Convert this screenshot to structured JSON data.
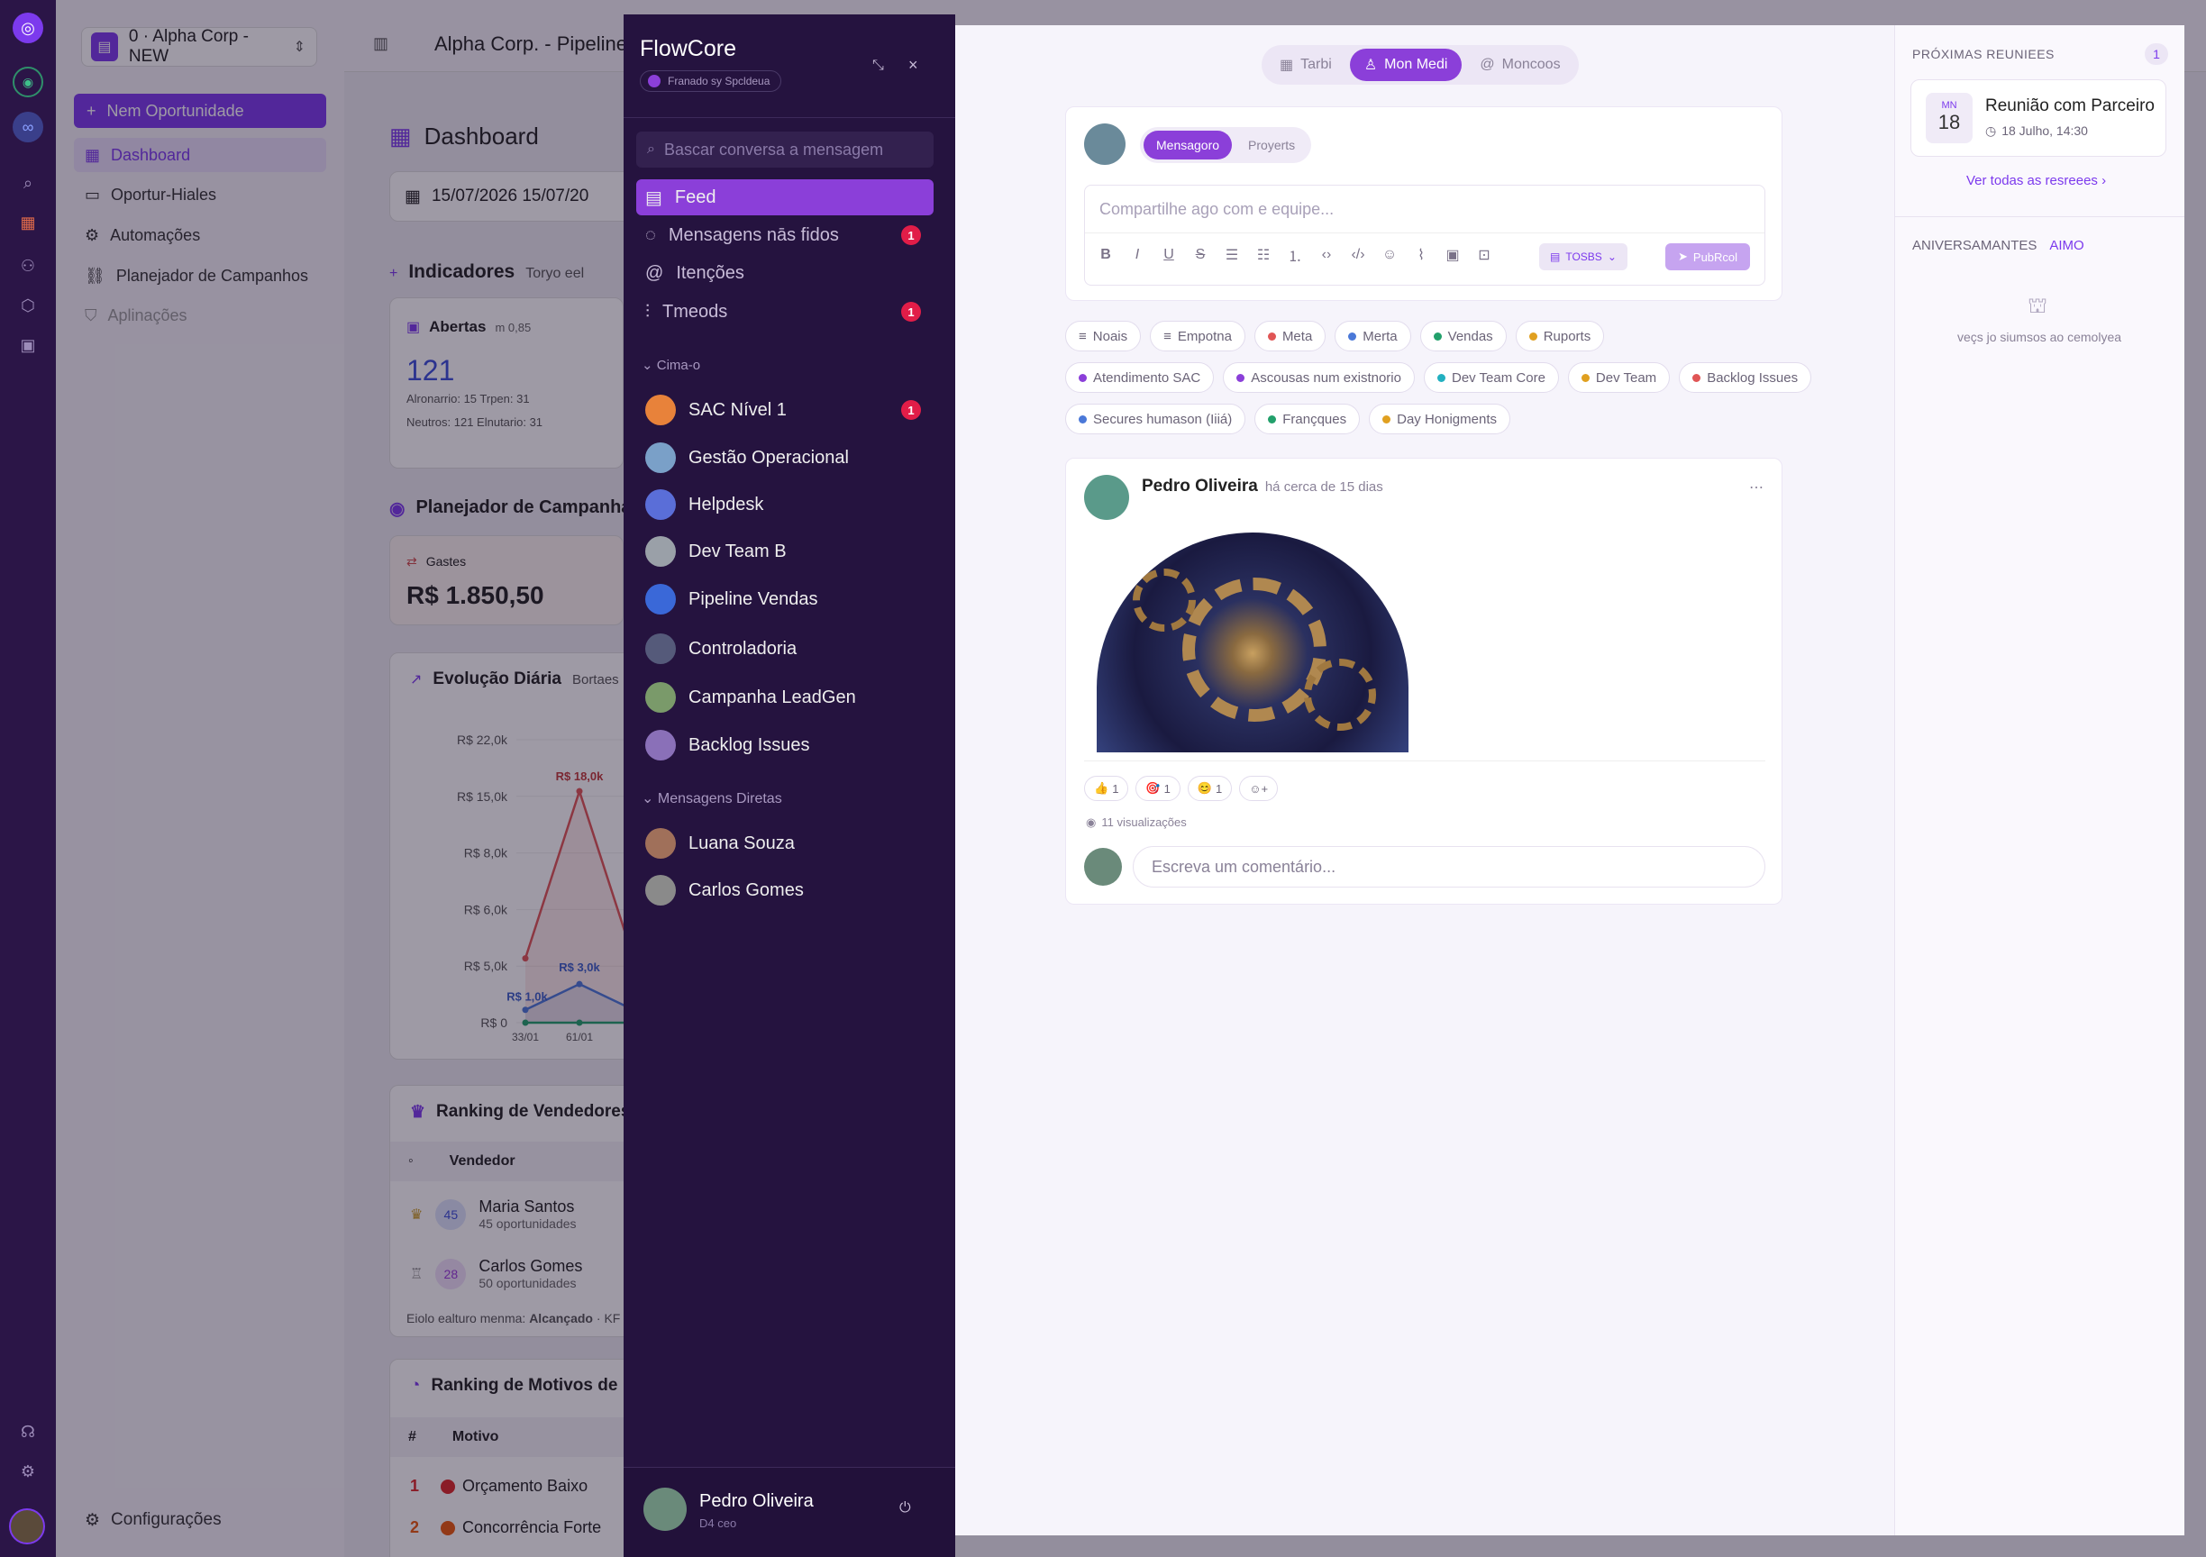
{
  "colors": {
    "rail": "#2b1547",
    "chat": "#25133f",
    "accent": "#8b3fd9",
    "badge": "#e11d48"
  },
  "bg_app": {
    "workspace": "0 · Alpha Corp - NEW",
    "header_title": "Alpha Corp. - Pipeline",
    "new_button": "Nem Oportunidade",
    "nav": [
      {
        "label": "Dashboard",
        "icon": "grid-icon",
        "active": true
      },
      {
        "label": "Oportur-Hiales",
        "icon": "briefcase-icon"
      },
      {
        "label": "Automações",
        "icon": "bot-icon"
      },
      {
        "label": "Planejador de Campanhos",
        "icon": "link-icon"
      },
      {
        "label": "Aplinações",
        "icon": "shield-icon",
        "disabled": true
      }
    ],
    "settings": "Configurações",
    "page_title": "Dashboard",
    "date_range": "15/07/2026   15/07/20",
    "indicators_title": "Indicadores",
    "indicators_sub": "Toryo eel",
    "open_label": "Abertas",
    "open_meta": "m 0,85",
    "open_value": "121",
    "open_line1": "Alronarrio: 15   Trpen: 31",
    "open_line2": "Neutros: 121   Elnutario: 31",
    "planner_title": "Planejador de Campanha",
    "spend_label": "Gastes",
    "spend_value": "R$ 1.850,50",
    "evolution_title": "Evolução Diária",
    "evolution_sub": "Bortaes",
    "chart_peak_red": "R$ 18,0k",
    "chart_peak_blue": "R$ 3,0k",
    "chart_left_blue": "R$ 1,0k",
    "ranking_sellers_title": "Ranking de Vendedores",
    "seller_col": "Vendedor",
    "sellers": [
      {
        "name": "Maria Santos",
        "sub": "45 oportunidades",
        "count": "45"
      },
      {
        "name": "Carlos Gomes",
        "sub": "50 oportunidades",
        "count": "28"
      }
    ],
    "goal_line": "Eiolo ealturo menma:",
    "goal_bold": "Alcançado",
    "goal_tail": "· KF",
    "ranking_reasons_title": "Ranking de Motivos de",
    "reasons_hash": "#",
    "reasons_col": "Motivo",
    "reasons": [
      {
        "rank": "1",
        "label": "Orçamento Baixo",
        "color": "#dc2626"
      },
      {
        "rank": "2",
        "label": "Concorrência Forte",
        "color": "#ea580c"
      }
    ]
  },
  "chart_data": {
    "type": "area",
    "title": "Evolução Diária",
    "categories": [
      "33/01",
      "61/01"
    ],
    "yticks": [
      "R$ 22,0k",
      "R$ 15,0k",
      "R$ 8,0k",
      "R$ 6,0k",
      "R$ 5,0k",
      "R$ 0"
    ],
    "series": [
      {
        "color": "#e05555",
        "values": [
          5,
          18,
          5
        ]
      },
      {
        "color": "#4a78d8",
        "values": [
          1,
          3,
          1
        ]
      },
      {
        "color": "#22a06b",
        "values": [
          0,
          0,
          0
        ]
      }
    ]
  },
  "chat": {
    "app_name": "FlowCore",
    "powered": "Franado sy Spcldeua",
    "search_placeholder": "Bascar conversa a mensagem",
    "menu": [
      {
        "label": "Feed",
        "icon": "feed-icon",
        "active": true,
        "badge": ""
      },
      {
        "label": "Mensagens nās fidos",
        "icon": "chat-bubble-icon",
        "badge": "1"
      },
      {
        "label": "Itenções",
        "icon": "at-icon",
        "badge": ""
      },
      {
        "label": "Tmeods",
        "icon": "thread-icon",
        "badge": "1"
      }
    ],
    "channels_header": "Cima-o",
    "channels": [
      {
        "name": "SAC Nível 1",
        "badge": "1",
        "color": "#e8823a"
      },
      {
        "name": "Gestão Operacional",
        "badge": "",
        "color": "#7aa0c8"
      },
      {
        "name": "Helpdesk",
        "badge": "",
        "color": "#5a6ed8"
      },
      {
        "name": "Dev Team B",
        "badge": "",
        "color": "#9aa0a8"
      },
      {
        "name": "Pipeline Vendas",
        "badge": "",
        "color": "#3a68d8"
      },
      {
        "name": "Controladoria",
        "badge": "",
        "color": "#555a7a"
      },
      {
        "name": "Campanha LeadGen",
        "badge": "",
        "color": "#7a9a6a"
      },
      {
        "name": "Backlog Issues",
        "badge": "",
        "color": "#8a70b8"
      }
    ],
    "dm_header": "Mensagens Diretas",
    "dms": [
      {
        "name": "Luana Souza",
        "color": "#a0705a"
      },
      {
        "name": "Carlos Gomes",
        "color": "#8a8a8a"
      }
    ],
    "user_name": "Pedro Oliveira",
    "user_status": "D4 ceo"
  },
  "feed": {
    "tabs": [
      {
        "label": "Tarbi",
        "icon": "calendar-icon",
        "active": false
      },
      {
        "label": "Mon Medi",
        "icon": "user-icon",
        "active": true
      },
      {
        "label": "Moncoos",
        "icon": "at-icon",
        "active": false
      }
    ],
    "composer_tab_active": "Mensagoro",
    "composer_tab_other": "Proyerts",
    "composer_placeholder": "Compartilhe ago com e equipe...",
    "visibility": "TOSBS",
    "publish": "PubRcol",
    "tags": [
      {
        "label": "Noais",
        "color": "",
        "icon": true
      },
      {
        "label": "Empotna",
        "color": "",
        "icon": true
      },
      {
        "label": "Meta",
        "color": "#e05555"
      },
      {
        "label": "Merta",
        "color": "#4a78d8"
      },
      {
        "label": "Vendas",
        "color": "#22a06b"
      },
      {
        "label": "Ruports",
        "color": "#e0a020"
      },
      {
        "label": "Atendimento SAC",
        "color": "#8b3fd9"
      },
      {
        "label": "Ascousas num existnorio",
        "color": "#8b3fd9"
      },
      {
        "label": "Dev Team Core",
        "color": "#22b0c0"
      },
      {
        "label": "Dev Team",
        "color": "#e0a020"
      },
      {
        "label": "Backlog Issues",
        "color": "#e05555"
      },
      {
        "label": "Secures humason (Iiiá)",
        "color": "#4a78d8"
      },
      {
        "label": "Françques",
        "color": "#22a06b"
      },
      {
        "label": "Day Honigments",
        "color": "#e0a020"
      }
    ],
    "post": {
      "author": "Pedro Oliveira",
      "time": "há cerca de 15 dias",
      "reactions": [
        {
          "emoji": "👍",
          "count": "1"
        },
        {
          "emoji": "🎯",
          "count": "1"
        },
        {
          "emoji": "😊",
          "count": "1"
        }
      ],
      "views": "11 visualizações",
      "comment_placeholder": "Escreva um comentário..."
    }
  },
  "right_panel": {
    "meetings_title": "PRÓXIMAS REUNIEES",
    "meetings_count": "1",
    "meeting_month": "MN",
    "meeting_day": "18",
    "meeting_title": "Reunião com Parceiro",
    "meeting_time": "18 Julho, 14:30",
    "see_all": "Ver todas as resreees",
    "birthdays_title": "ANIVERSAMANTES",
    "birthdays_tab": "AIMO",
    "birthdays_empty": "veçs jo siumsos ao cemolyea"
  }
}
